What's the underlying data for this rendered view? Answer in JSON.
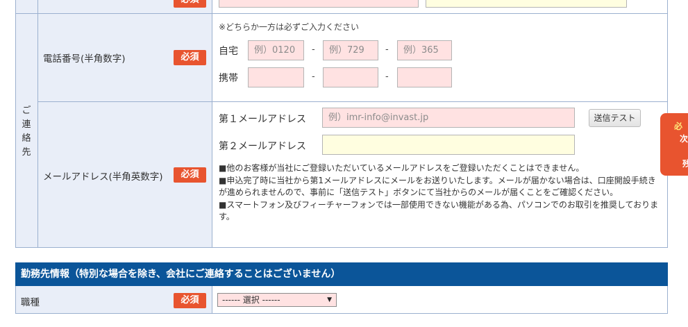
{
  "top_row": {
    "required_badge": "必須"
  },
  "contact_group": {
    "label_chars": [
      "ご",
      "連",
      "絡",
      "先"
    ]
  },
  "phone": {
    "label": "電話番号(半角数字)",
    "required_badge": "必須",
    "note": "※どちらか一方は必ずご入力ください",
    "home_label": "自宅",
    "mobile_label": "携帯",
    "dash": "-",
    "home_placeholders": [
      "例）0120",
      "例）729",
      "例）365"
    ],
    "mobile_values": [
      "",
      "",
      ""
    ]
  },
  "email": {
    "label": "メールアドレス(半角英数字)",
    "required_badge": "必須",
    "first_label": "第１メールアドレス",
    "first_placeholder": "例）imr-info@invast.jp",
    "second_label": "第２メールアドレス",
    "second_value": "",
    "test_button": "送信テスト",
    "notes": [
      "■他のお客様が当社にご登録いただいているメールアドレスをご登録いただくことはできません。",
      "■申込完了時に当社から第1メールアドレスにメールをお送りいたします。メールが届かない場合は、口座開設手続きが進められませんので、事前に「送信テスト」ボタンにて当社からのメールが届くことをご確認ください。",
      "■スマートフォン及びフィーチャーフォンでは一部使用できない機能がある為、パソコンでのお取引を推奨しております。"
    ]
  },
  "employer_section": {
    "header": "勤務先情報（特別な場合を除き、会社にご連絡することはございません）",
    "occupation_label": "職種",
    "required_badge": "必須",
    "occupation_select": "------ 選択 ------"
  },
  "side_tab": {
    "chars": [
      "必",
      "次",
      "残"
    ]
  },
  "colors": {
    "required": "#e8542f",
    "header": "#0b5599",
    "label_bg": "#e9eef8",
    "input_pink": "#ffe2e2",
    "input_yellow": "#fffee0"
  }
}
